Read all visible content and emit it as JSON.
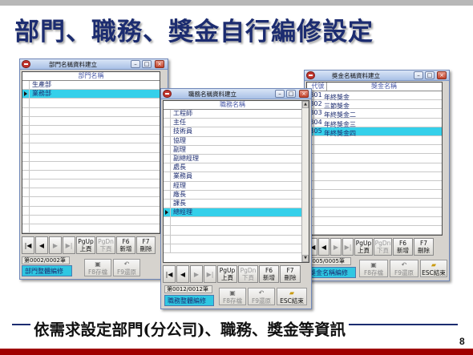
{
  "slide": {
    "title": "部門、職務、獎金自行編修設定",
    "caption": "依需求設定部門(分公司)、職務、獎金等資訊",
    "page_number": "8"
  },
  "windows": {
    "dept": {
      "title": "部門名稱資料建立",
      "column": "部門名稱",
      "rows": [
        "生產部",
        "業務部"
      ],
      "selected_index": 1,
      "status": "第0002/0002筆",
      "tab": "部門整體編修"
    },
    "job": {
      "title": "職務名稱資料建立",
      "column": "職務名稱",
      "rows": [
        "工程師",
        "主任",
        "技術員",
        "協理",
        "副理",
        "副總經理",
        "處長",
        "業務員",
        "經理",
        "廠長",
        "課長",
        "總經理"
      ],
      "selected_index": 11,
      "status": "第0012/0012筆",
      "tab": "職務整體編修"
    },
    "bonus": {
      "title": "獎金名稱資料建立",
      "code_column": "代號",
      "column": "獎金名稱",
      "rows": [
        {
          "code": "B01",
          "name": "年終獎金"
        },
        {
          "code": "B02",
          "name": "三節獎金"
        },
        {
          "code": "B03",
          "name": "年終獎金二"
        },
        {
          "code": "B04",
          "name": "年終獎金三"
        },
        {
          "code": "B05",
          "name": "年終獎金四"
        }
      ],
      "selected_index": 4,
      "status": "0005/0005筆",
      "tab": "獎金名稱編修"
    }
  },
  "nav": {
    "first": "|◀",
    "prev": "◀",
    "next": "▶",
    "last": "▶|",
    "pgup_1": "PgUp",
    "pgup_2": "上頁",
    "pgdn_1": "PgDn",
    "pgdn_2": "下頁",
    "f6_1": "F6",
    "f6_2": "新增",
    "f7_1": "F7",
    "f7_2": "刪除"
  },
  "footer": {
    "f8": "F8存檔",
    "f9": "F9還原",
    "esc": "ESC結束"
  },
  "window_buttons": {
    "min": "–",
    "max": "□",
    "close": "×"
  },
  "icons": {
    "app": "app-icon",
    "save": "save-icon",
    "undo": "undo-icon",
    "exit": "folder-exit-icon"
  },
  "colors": {
    "title_text": "#1c2c70",
    "selection": "#35d0ea",
    "bottom_bar": "#a00000"
  }
}
